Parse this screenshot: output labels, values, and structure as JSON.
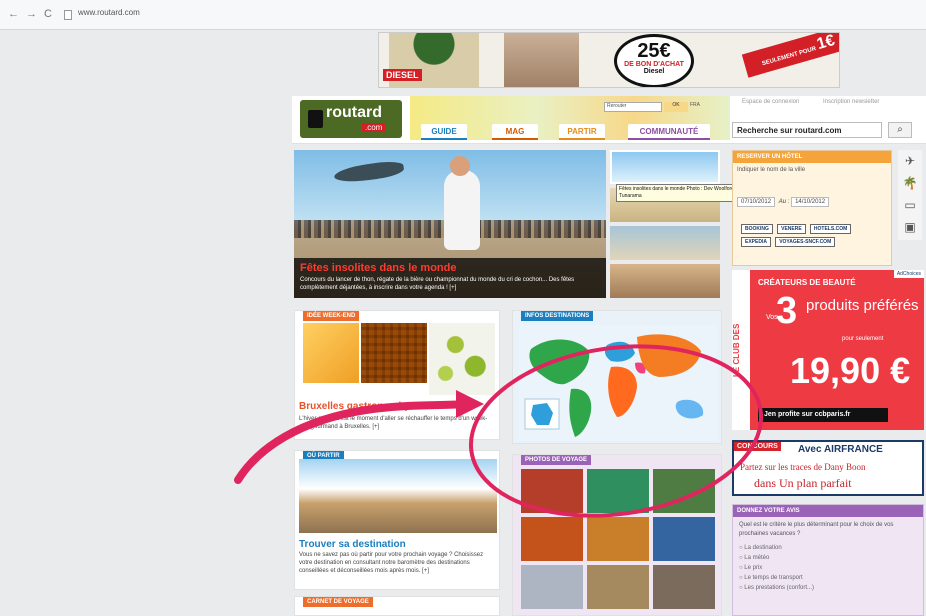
{
  "browser": {
    "back": "←",
    "forward": "→",
    "reload": "C",
    "url": "www.routard.com"
  },
  "banner": {
    "brand": "DIESEL",
    "amount": "25€",
    "offer": "DE BON D'ACHAT",
    "offer_brand": "Diesel",
    "ribbon_small": "SEULEMENT POUR",
    "ribbon_price": "1€"
  },
  "header": {
    "logo_word": "routard",
    "logo_com": ".com",
    "mini_search": "Rerouter",
    "mini_btn": "OK",
    "mini_lang": "FRA",
    "top_links": [
      "Espace de connexion",
      "Inscription newsletter"
    ],
    "tabs": [
      "GUIDE",
      "MAG",
      "PARTIR",
      "COMMUNAUTÉ"
    ],
    "search_placeholder": "Recherche sur routard.com",
    "search_icon": "⌕"
  },
  "hero": {
    "title": "Fêtes insolites dans le monde",
    "text": "Concours du lancer de thon, régate de la bière ou championnat du monde du cri de cochon... Des fêtes complètement déjantées, à inscrire dans votre agenda ! [+]",
    "tooltip": "Fêtes insolites dans le monde Photo : Dev Woolford / Tunarama"
  },
  "hotel": {
    "header": "RESERVER UN HÔTEL",
    "city_label": "Indiquer le nom de la ville",
    "date_in": "07/10/2012",
    "date_out_label": "Au :",
    "date_out": "14/10/2012",
    "links": [
      "BOOKING",
      "VENERE",
      "HOTELS.COM",
      "EXPEDIA",
      "VOYAGES-SNCF.COM"
    ]
  },
  "side_icons": [
    "plane-icon",
    "palm-icon",
    "bed-icon",
    "car-icon"
  ],
  "ad": {
    "adchoices": "AdChoices",
    "vertical": "LE CLUB DES",
    "title": "CRÉATEURS DE BEAUTÉ",
    "vos": "Vos",
    "big": "3",
    "produits": "produits préférés",
    "seulement": "pour seulement",
    "price": "19,90 €",
    "cta": "Jen profite sur ccbparis.fr"
  },
  "concours": {
    "tag": "CONCOURS",
    "airline": "Avec AIRFRANCE",
    "line1": "Partez sur les traces de Dany Boon",
    "line2": "dans Un plan parfait"
  },
  "poll": {
    "header": "DONNEZ VOTRE AVIS",
    "question": "Quel est le critère le plus déterminant pour le choix de vos prochaines vacances ?",
    "options": [
      "La destination",
      "La météo",
      "Le prix",
      "Le temps de transport",
      "Les prestations (confort...)"
    ]
  },
  "cards": {
    "weekend": {
      "tag": "IDÉE WEEK-END",
      "title": "Bruxelles gastronomique",
      "text": "L'hiver arrive, c'est le moment d'aller se réchauffer le temps d'un week-end gourmand à Bruxelles. [+]"
    },
    "infos": {
      "tag": "INFOS DESTINATIONS"
    },
    "oupartir": {
      "tag": "OÙ PARTIR",
      "title": "Trouver sa destination",
      "text": "Vous ne savez pas où partir pour votre prochain voyage ? Choisissez votre destination en consultant notre baromètre des destinations conseillées et déconseillées mois après mois. [+]"
    },
    "photos": {
      "tag": "PHOTOS DE VOYAGE",
      "colors": [
        "#b43e2a",
        "#2f8f5f",
        "#4f7c43",
        "#c4531b",
        "#c97f2a",
        "#3465a0",
        "#aeb5c2",
        "#a5895f",
        "#7a6b5c"
      ]
    },
    "carnet": {
      "tag": "CARNET DE VOYAGE"
    }
  },
  "colors": {
    "annotation": "#e0245e",
    "map_europe": "#2f9fdb",
    "map_asia": "#f47d23",
    "map_africa": "#ff6a1f",
    "map_americas": "#2fa64a",
    "map_oceania": "#65b6f1",
    "map_middle_east": "#f0427f"
  }
}
